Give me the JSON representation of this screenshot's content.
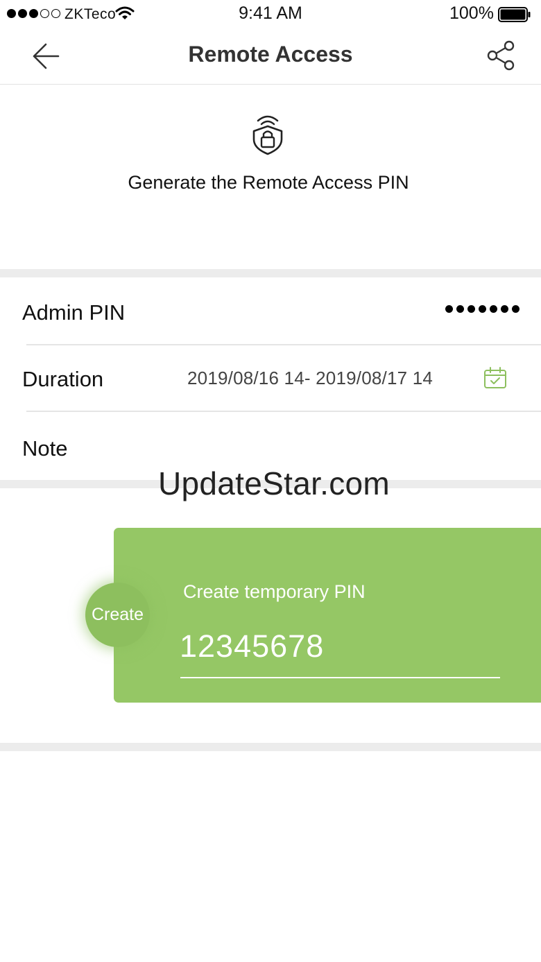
{
  "status_bar": {
    "carrier": "ZKTeco",
    "time": "9:41 AM",
    "battery": "100%"
  },
  "nav": {
    "title": "Remote Access",
    "back_icon": "arrow-left-icon",
    "share_icon": "share-icon"
  },
  "header": {
    "icon": "wireless-lock-shield-icon",
    "text": "Generate the Remote Access PIN"
  },
  "form": {
    "admin_pin_label": "Admin PIN",
    "admin_pin_mask": "•••••••",
    "duration_label": "Duration",
    "duration_value": "2019/08/16 14- 2019/08/17 14",
    "calendar_icon": "calendar-check-icon",
    "note_label": "Note"
  },
  "watermark": "UpdateStar.com",
  "pin_card": {
    "create_button": "Create",
    "caption": "Create temporary PIN",
    "pin": "12345678"
  },
  "colors": {
    "accent_green": "#95c765",
    "divider": "#ececec"
  }
}
